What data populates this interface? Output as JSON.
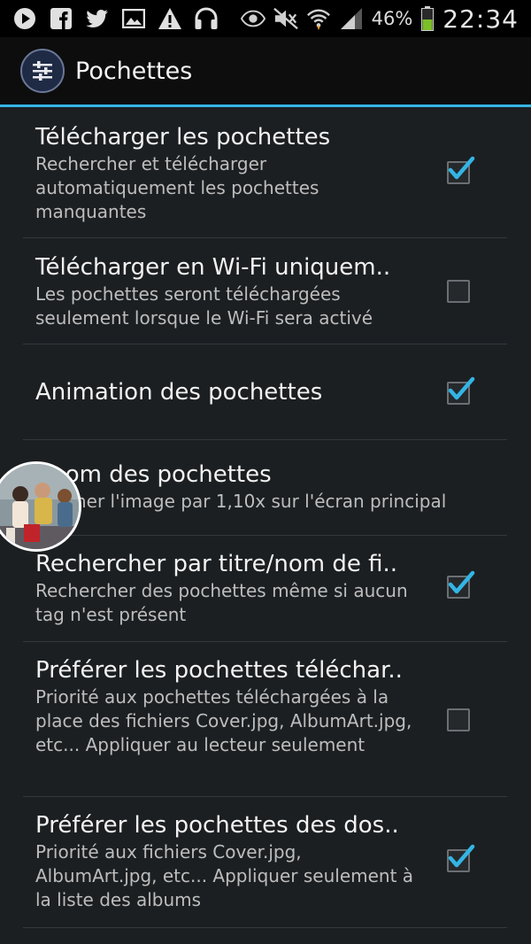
{
  "status_bar": {
    "battery_percent": "46%",
    "time": "22:34",
    "left_icons": [
      "play-icon",
      "facebook-icon",
      "twitter-icon",
      "image-icon",
      "warning-icon",
      "headphones-icon"
    ],
    "right_icons": [
      "eye-icon",
      "mute-icon",
      "wifi-icon",
      "signal-icon",
      "battery-icon"
    ]
  },
  "action_bar": {
    "title": "Pochettes",
    "icon": "equalizer-settings-icon"
  },
  "colors": {
    "accent": "#33b5e5",
    "background": "#1c1f22",
    "check": "#33b5e5"
  },
  "preferences": [
    {
      "title": "Télécharger les pochettes",
      "summary": "Rechercher et télécharger automatiquement les pochettes manquantes",
      "checked": true
    },
    {
      "title": "Télécharger en Wi-Fi uniquem..",
      "summary": "Les pochettes seront téléchargées seulement lorsque le Wi-Fi sera activé",
      "checked": false
    },
    {
      "title": "Animation des pochettes",
      "summary": "",
      "checked": true
    },
    {
      "title": "Zoom des pochettes",
      "summary": "Zoomer l'image par 1,10x sur l'écran principal"
    },
    {
      "title": "Rechercher par titre/nom de fi..",
      "summary": "Rechercher des pochettes même si aucun tag n'est présent",
      "checked": true
    },
    {
      "title": "Préférer les pochettes téléchar..",
      "summary": "Priorité aux pochettes téléchargées à la place des fichiers Cover.jpg, AlbumArt.jpg, etc... Appliquer au lecteur seulement",
      "checked": false
    },
    {
      "title": "Préférer les pochettes des dos..",
      "summary": "Priorité aux fichiers Cover.jpg, AlbumArt.jpg, etc... Appliquer seulement à la liste des albums",
      "checked": true
    }
  ],
  "overlay": {
    "type": "chat-head-avatar"
  }
}
